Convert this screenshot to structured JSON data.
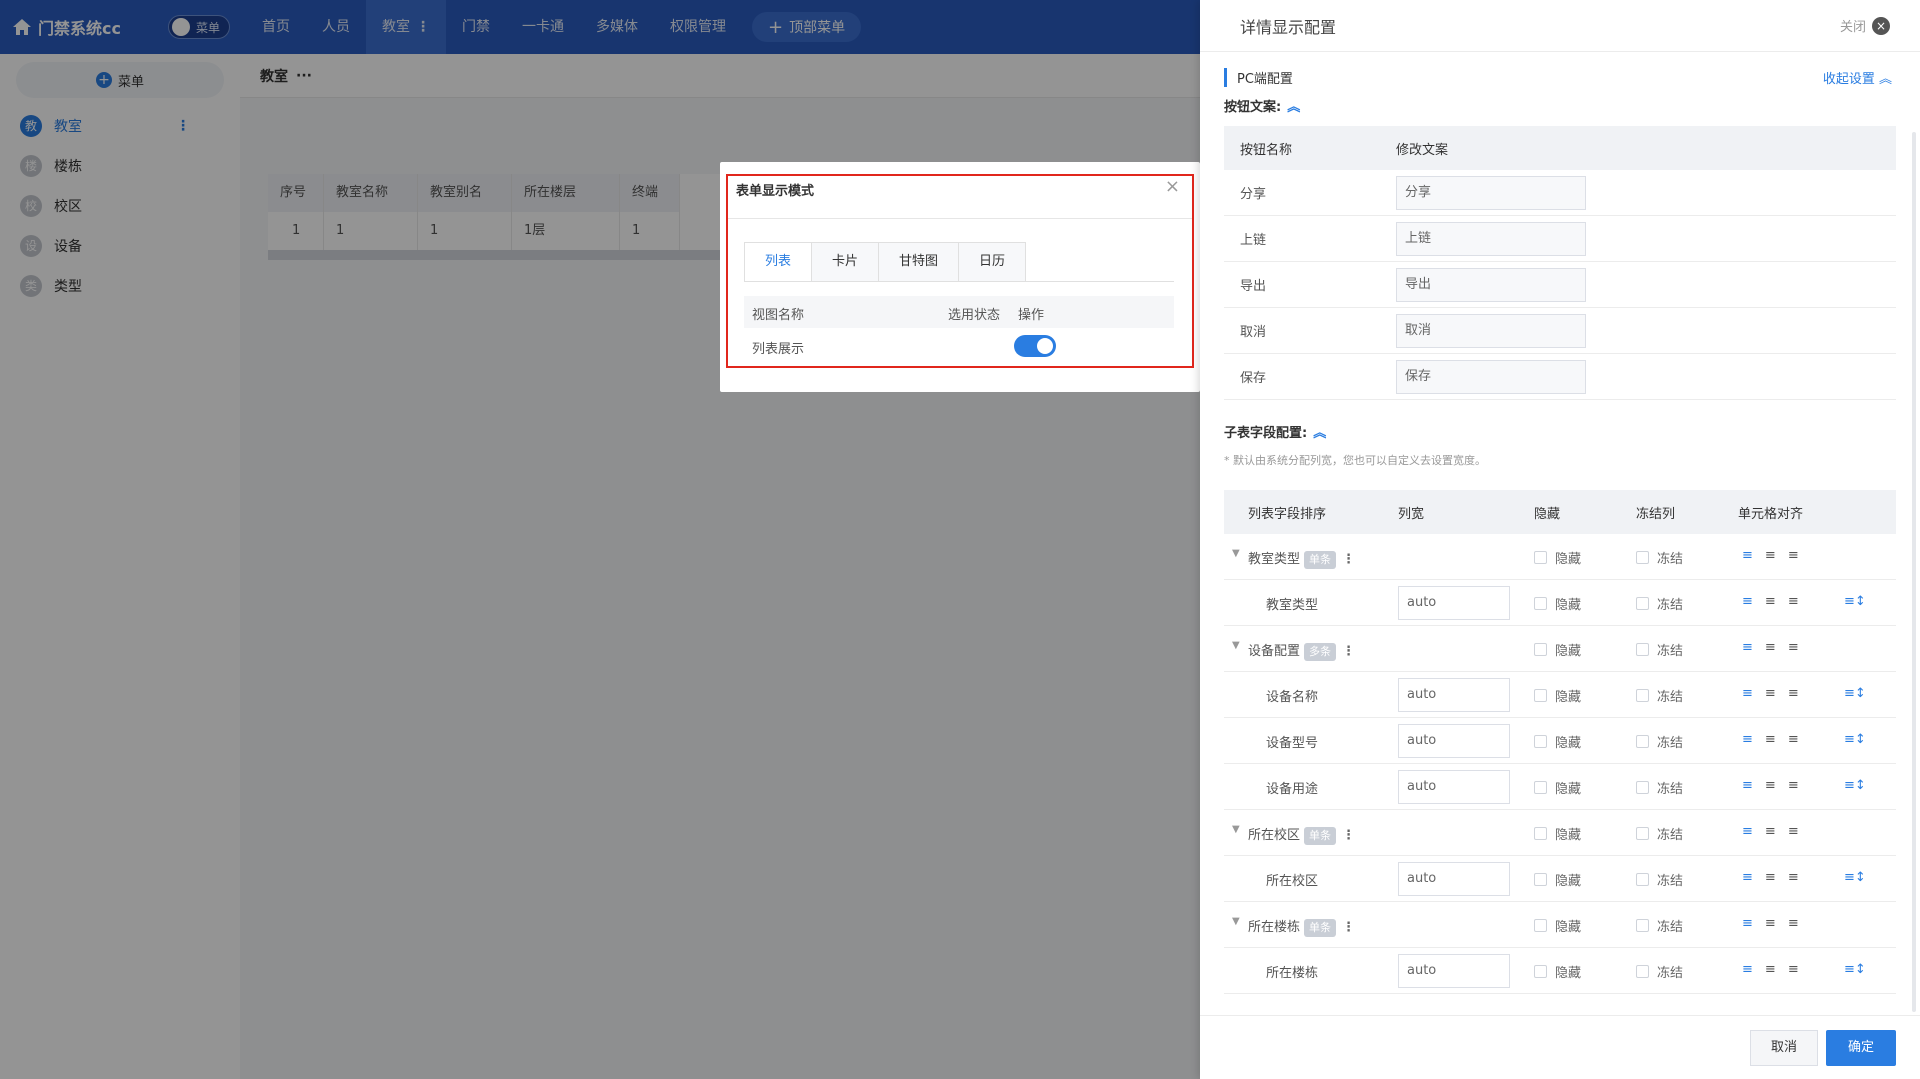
{
  "app": {
    "title": "门禁系统cc",
    "menu_toggle_label": "菜单"
  },
  "topnav": {
    "items": [
      {
        "label": "首页"
      },
      {
        "label": "人员"
      },
      {
        "label": "教室"
      },
      {
        "label": "门禁"
      },
      {
        "label": "一卡通"
      },
      {
        "label": "多媒体"
      },
      {
        "label": "权限管理"
      }
    ],
    "active_index": 2,
    "add_label": "顶部菜单"
  },
  "sidebar": {
    "add_label": "菜单",
    "items": [
      {
        "badge": "教",
        "label": "教室"
      },
      {
        "badge": "楼",
        "label": "楼栋"
      },
      {
        "badge": "校",
        "label": "校区"
      },
      {
        "badge": "设",
        "label": "设备"
      },
      {
        "badge": "类",
        "label": "类型"
      }
    ]
  },
  "main": {
    "breadcrumb": "教室",
    "breadcrumb_more": "···",
    "table": {
      "columns": [
        "序号",
        "教室名称",
        "教室别名",
        "所在楼层",
        "终端"
      ],
      "rows": [
        [
          "1",
          "1",
          "1",
          "1层",
          "1"
        ]
      ]
    }
  },
  "modal": {
    "title": "表单显示模式",
    "close_glyph": "×",
    "tabs": [
      "列表",
      "卡片",
      "甘特图",
      "日历"
    ],
    "active_tab": 0,
    "columns": [
      "视图名称",
      "选用状态",
      "操作"
    ],
    "row": {
      "name": "列表展示",
      "enabled": true
    }
  },
  "drawer": {
    "title": "详情显示配置",
    "close_label": "关闭",
    "section_pc": "PC端配置",
    "collapse_label": "收起设置",
    "button_text_title": "按钮文案:",
    "button_table": {
      "headers": [
        "按钮名称",
        "修改文案"
      ],
      "rows": [
        {
          "name": "分享",
          "value": "分享"
        },
        {
          "name": "上链",
          "value": "上链"
        },
        {
          "name": "导出",
          "value": "导出"
        },
        {
          "name": "取消",
          "value": "取消"
        },
        {
          "name": "保存",
          "value": "保存"
        }
      ]
    },
    "subtable_title": "子表字段配置:",
    "subtable_note": "* 默认由系统分配列宽，您也可以自定义去设置宽度。",
    "field_table": {
      "headers": [
        "列表字段排序",
        "列宽",
        "隐藏",
        "冻结列",
        "单元格对齐"
      ],
      "hide_label": "隐藏",
      "freeze_label": "冻结",
      "rows": [
        {
          "type": "group",
          "name": "教室类型",
          "tag": "单条"
        },
        {
          "type": "child",
          "name": "教室类型",
          "width": "auto"
        },
        {
          "type": "group",
          "name": "设备配置",
          "tag": "多条"
        },
        {
          "type": "child",
          "name": "设备名称",
          "width": "auto"
        },
        {
          "type": "child",
          "name": "设备型号",
          "width": "auto"
        },
        {
          "type": "child",
          "name": "设备用途",
          "width": "auto"
        },
        {
          "type": "group",
          "name": "所在校区",
          "tag": "单条"
        },
        {
          "type": "child",
          "name": "所在校区",
          "width": "auto"
        },
        {
          "type": "group",
          "name": "所在楼栋",
          "tag": "单条"
        },
        {
          "type": "child",
          "name": "所在楼栋",
          "width": "auto"
        }
      ]
    },
    "footer": {
      "cancel_label": "取消",
      "ok_label": "确定"
    }
  },
  "colors": {
    "primary": "#2a7de1",
    "topbar": "#2a5cc0",
    "highlight": "#e1261c"
  }
}
